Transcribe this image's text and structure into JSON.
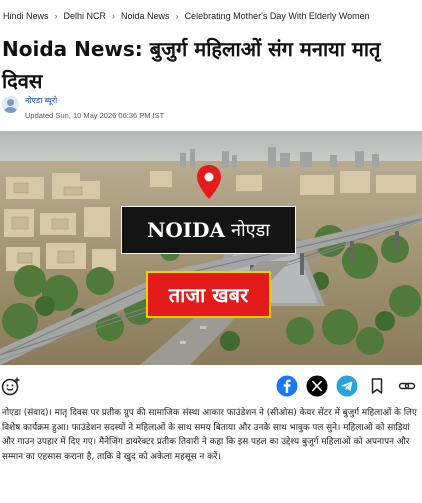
{
  "breadcrumb": {
    "items": [
      "Hindi News",
      "Delhi NCR",
      "Noida News",
      "Celebrating Mother's Day With Elderly Women"
    ],
    "separator": "›"
  },
  "article": {
    "title": "Noida News: बुजुर्ग महिलाओं संग मनाया मातृ दिवस",
    "author": "नोएडा ब्यूरो",
    "updated": "Updated Sun, 10 May 2026 06:36 PM IST",
    "body": "नोएडा (संवाद)। मातृ दिवस पर प्रतीक ग्रुप की सामाजिक संस्था आकार फाउंडेशन ने (सीओस) केयर सेंटर में बुजुर्ग महिलाओं के लिए विशेष कार्यक्रम हुआ। फाउंडेशन सदस्यों ने महिलाओं के साथ समय बिताया और उनके साथ भावुक पल सुने। महिलाओं को साड़ियां और गाउन उपहार में दिए गए। मैनेजिंग डायरेक्टर प्रतीक तिवारी ने कहा कि इस पहल का उद्देश्य बुजुर्ग महिलाओं को अपनापन और सम्मान का एहसास कराना है, ताकि वे खुद को अकेला महसूस न करें।"
  },
  "hero": {
    "city_label": "NOIDA",
    "city_label_hi": "नोएडा",
    "news_label": "ताजा खबर",
    "pin_color": "#e31b1b",
    "news_bg": "#e31b1b",
    "news_border": "#f4d000"
  },
  "share": {
    "icons": [
      "emoji-reaction-icon",
      "facebook-icon",
      "x-icon",
      "telegram-icon",
      "bookmark-icon",
      "link-icon"
    ],
    "facebook_color": "#1877f2",
    "telegram_color": "#2aa3dc"
  }
}
